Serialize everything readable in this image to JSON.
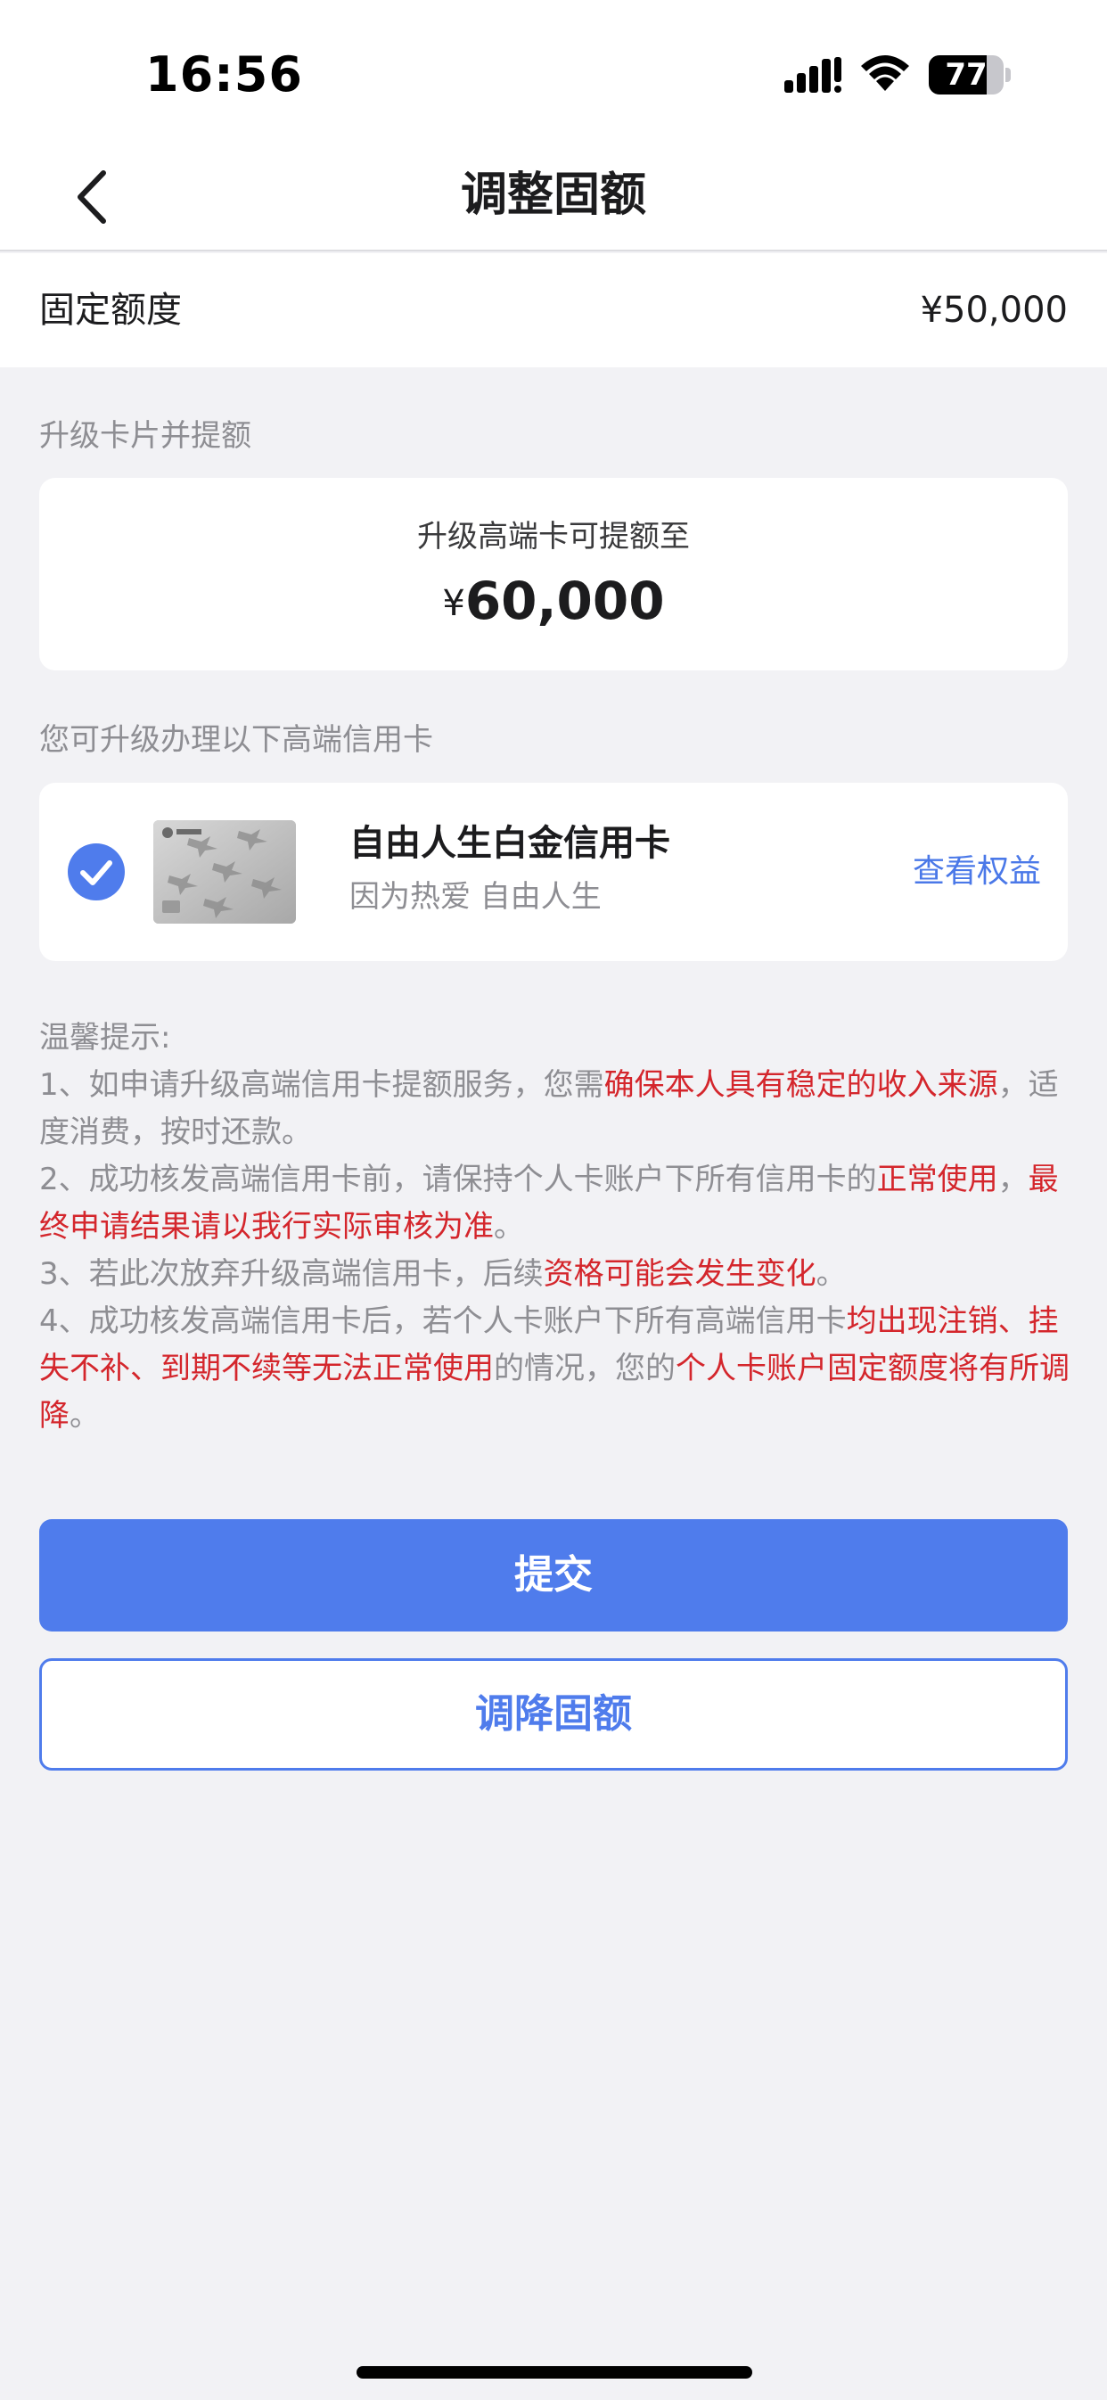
{
  "status_bar": {
    "time": "16:56",
    "battery": "77",
    "battery_level": 0.77,
    "icons": [
      "signal-icon",
      "wifi-icon",
      "battery-icon"
    ]
  },
  "nav": {
    "title": "调整固额",
    "back_icon": "chevron-left-icon"
  },
  "fixed_limit": {
    "label": "固定额度",
    "value": "¥50,000"
  },
  "upgrade": {
    "section_title": "升级卡片并提额",
    "card_label": "升级高端卡可提额至",
    "currency": "¥",
    "amount": "60,000"
  },
  "cards": {
    "section_title": "您可升级办理以下高端信用卡",
    "items": [
      {
        "name": "自由人生白金信用卡",
        "slogan": "因为热爱 自由人生",
        "link": "查看权益",
        "selected": true
      }
    ]
  },
  "tips": {
    "title": "温馨提示:",
    "items": [
      [
        {
          "text": "1、如申请升级高端信用卡提额服务，您需",
          "highlight": false
        },
        {
          "text": "确保本人具有稳定的收入来源",
          "highlight": true
        },
        {
          "text": "，适度消费，按时还款。",
          "highlight": false
        }
      ],
      [
        {
          "text": "2、成功核发高端信用卡前，请保持个人卡账户下所有信用卡的",
          "highlight": false
        },
        {
          "text": "正常使用",
          "highlight": true
        },
        {
          "text": "，",
          "highlight": false
        },
        {
          "text": "最终申请结果请以我行实际审核为准",
          "highlight": true
        },
        {
          "text": "。",
          "highlight": false
        }
      ],
      [
        {
          "text": "3、若此次放弃升级高端信用卡，后续",
          "highlight": false
        },
        {
          "text": "资格可能会发生变化",
          "highlight": true
        },
        {
          "text": "。",
          "highlight": false
        }
      ],
      [
        {
          "text": "4、成功核发高端信用卡后，若个人卡账户下所有高端信用卡",
          "highlight": false
        },
        {
          "text": "均出现注销、挂失不补、到期不续等无法正常使用",
          "highlight": true
        },
        {
          "text": "的情况，您的",
          "highlight": false
        },
        {
          "text": "个人卡账户固定额度将有所调降",
          "highlight": true
        },
        {
          "text": "。",
          "highlight": false
        }
      ]
    ]
  },
  "actions": {
    "submit_label": "提交",
    "reduce_label": "调降固额"
  },
  "colors": {
    "accent": "#4f7cec",
    "highlight": "#d4262c",
    "muted": "#8e8e93",
    "background": "#f2f2f5"
  }
}
